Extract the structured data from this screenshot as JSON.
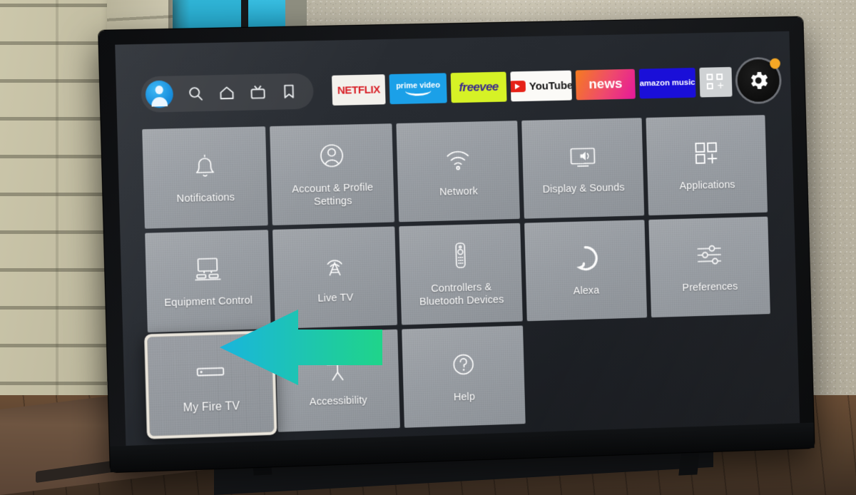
{
  "scene": {
    "description": "Amazon Fire TV Settings menu shown on a wall-mounted television",
    "annotation_arrow_color_start": "#19b5dd",
    "annotation_arrow_color_end": "#1fd48a"
  },
  "topbar": {
    "profile": {
      "name": "profile-avatar",
      "label": "Profile"
    },
    "nav_icons": [
      {
        "name": "search-icon",
        "label": "Search"
      },
      {
        "name": "home-icon",
        "label": "Home"
      },
      {
        "name": "live-tv-icon",
        "label": "Live TV"
      },
      {
        "name": "bookmark-icon",
        "label": "Watchlist"
      }
    ],
    "apps": [
      {
        "name": "netflix",
        "label": "NETFLIX"
      },
      {
        "name": "prime-video",
        "label": "prime video"
      },
      {
        "name": "freevee",
        "label": "freevee"
      },
      {
        "name": "youtube",
        "label": "YouTube"
      },
      {
        "name": "news",
        "label": "news"
      },
      {
        "name": "amazon-music",
        "label_brand": "amazon",
        "label_word": "music"
      },
      {
        "name": "app-library",
        "label": "Apps"
      }
    ],
    "settings_button": {
      "label": "Settings",
      "has_notification_dot": true
    }
  },
  "settings_grid": {
    "rows": [
      [
        {
          "label": "Notifications",
          "icon": "bell-icon",
          "focused": false
        },
        {
          "label": "Account & Profile Settings",
          "icon": "person-circle-icon",
          "focused": false
        },
        {
          "label": "Network",
          "icon": "wifi-icon",
          "focused": false
        },
        {
          "label": "Display & Sounds",
          "icon": "display-sound-icon",
          "focused": false
        },
        {
          "label": "Applications",
          "icon": "apps-grid-icon",
          "focused": false
        }
      ],
      [
        {
          "label": "Equipment Control",
          "icon": "equipment-icon",
          "focused": false
        },
        {
          "label": "Live TV",
          "icon": "broadcast-tower-icon",
          "focused": false
        },
        {
          "label": "Controllers & Bluetooth Devices",
          "icon": "remote-icon",
          "focused": false
        },
        {
          "label": "Alexa",
          "icon": "alexa-ring-icon",
          "focused": false
        },
        {
          "label": "Preferences",
          "icon": "sliders-icon",
          "focused": false
        }
      ],
      [
        {
          "label": "My Fire TV",
          "icon": "firestick-icon",
          "focused": true
        },
        {
          "label": "Accessibility",
          "icon": "accessibility-icon",
          "focused": false
        },
        {
          "label": "Help",
          "icon": "question-circle-icon",
          "focused": false
        }
      ]
    ]
  }
}
